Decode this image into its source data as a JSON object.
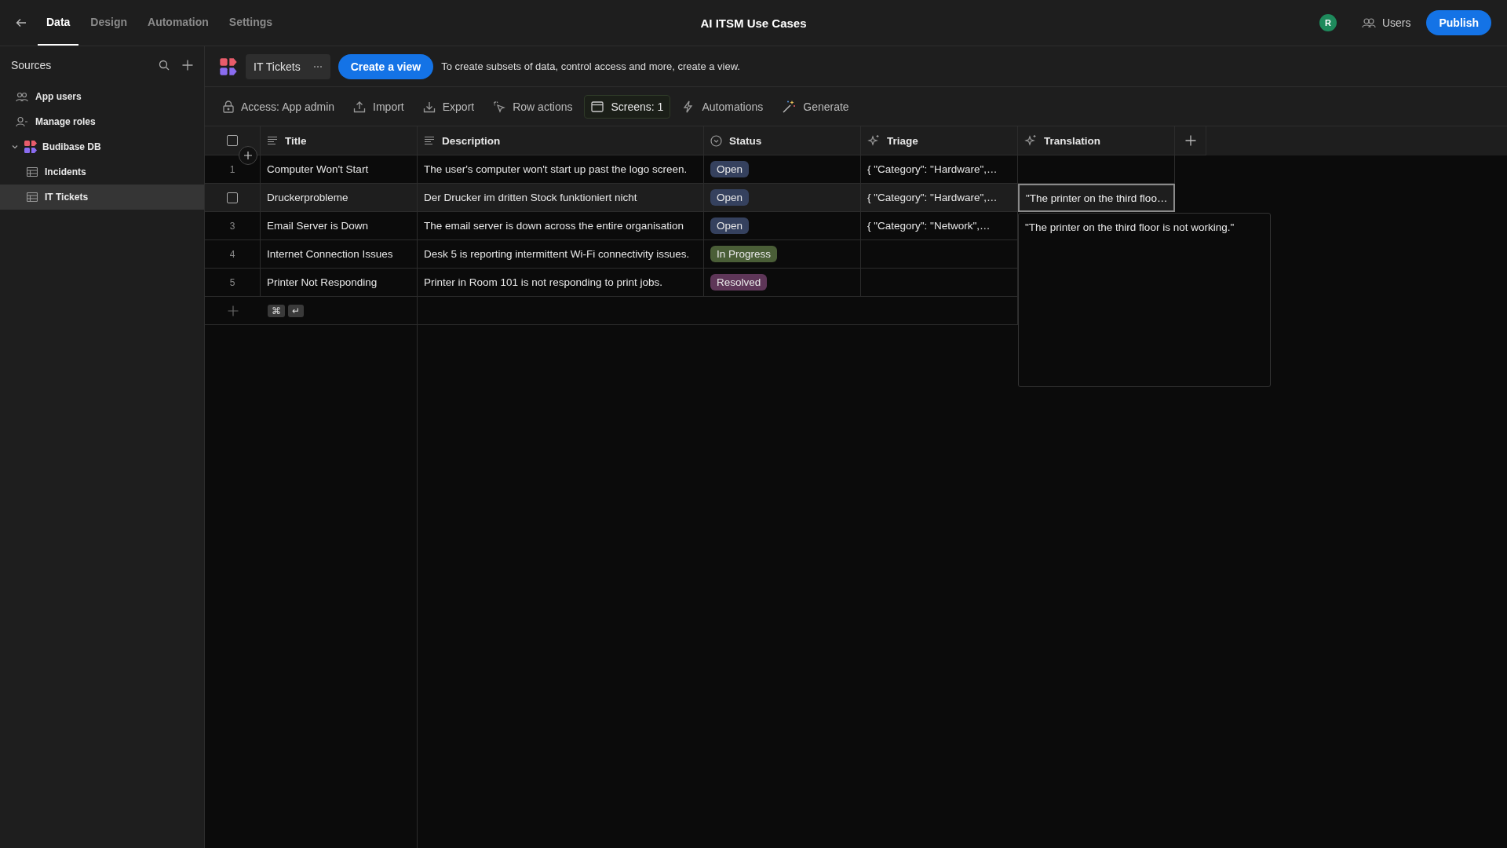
{
  "topbar": {
    "tabs": [
      {
        "label": "Data",
        "selected": true
      },
      {
        "label": "Design",
        "selected": false
      },
      {
        "label": "Automation",
        "selected": false
      },
      {
        "label": "Settings",
        "selected": false
      }
    ],
    "title": "AI ITSM Use Cases",
    "avatar": "R",
    "users": "Users",
    "publish": "Publish"
  },
  "sidebar": {
    "title": "Sources",
    "items": [
      {
        "label": "App users",
        "kind": "users",
        "selected": false
      },
      {
        "label": "Manage roles",
        "kind": "roles",
        "selected": false
      },
      {
        "label": "Budibase DB",
        "kind": "database",
        "selected": false,
        "expanded": true,
        "children": [
          {
            "label": "Incidents",
            "kind": "table",
            "selected": false
          },
          {
            "label": "IT Tickets",
            "kind": "table",
            "selected": true
          }
        ]
      }
    ]
  },
  "table_bar": {
    "name": "IT Tickets",
    "create_view": "Create a view",
    "hint": "To create subsets of data, control access and more, create a view."
  },
  "toolbar": [
    {
      "label": "Access: App admin",
      "kind": "lock",
      "active": false
    },
    {
      "label": "Import",
      "kind": "import",
      "active": false
    },
    {
      "label": "Export",
      "kind": "export",
      "active": false
    },
    {
      "label": "Row actions",
      "kind": "cursor",
      "active": false
    },
    {
      "label": "Screens: 1",
      "kind": "screen",
      "active": true
    },
    {
      "label": "Automations",
      "kind": "bolt",
      "active": false
    },
    {
      "label": "Generate",
      "kind": "wand",
      "active": false
    }
  ],
  "table": {
    "select_all_checked": false,
    "columns": [
      {
        "label": "Title",
        "kind": "text"
      },
      {
        "label": "Description",
        "kind": "text"
      },
      {
        "label": "Status",
        "kind": "options"
      },
      {
        "label": "Triage",
        "kind": "ai"
      },
      {
        "label": "Translation",
        "kind": "ai"
      }
    ],
    "rows": [
      {
        "number": "1",
        "highlighted": false,
        "title": "Computer Won't Start",
        "description": "The user's computer won't start up past the logo screen.",
        "status": {
          "label": "Open",
          "color": "#35415e"
        },
        "triage": "{ \"Category\": \"Hardware\",…",
        "translation_selected": false
      },
      {
        "highlighted": true,
        "checked": false,
        "title": "Druckerprobleme",
        "description": "Der Drucker im dritten Stock funktioniert nicht",
        "status": {
          "label": "Open",
          "color": "#35415e"
        },
        "triage": "{ \"Category\": \"Hardware\",…",
        "translation": "\"The printer on the third floo…",
        "translation_selected": true
      },
      {
        "number": "3",
        "highlighted": false,
        "title": "Email Server is Down",
        "description": "The email server is down across the entire organisation",
        "status": {
          "label": "Open",
          "color": "#35415e"
        },
        "triage": "{ \"Category\": \"Network\",…"
      },
      {
        "number": "4",
        "highlighted": false,
        "title": "Internet Connection Issues",
        "description": "Desk 5 is reporting intermittent Wi-Fi connectivity issues.",
        "status": {
          "label": "In Progress",
          "color": "#4a5e37"
        }
      },
      {
        "number": "5",
        "highlighted": false,
        "title": "Printer Not Responding",
        "description": "Printer in Room 101 is not responding to print jobs.",
        "status": {
          "label": "Resolved",
          "color": "#5e3658"
        }
      }
    ],
    "add_row_keys": [
      "⌘",
      "↵"
    ],
    "expanded_cell": {
      "text": "\"The printer on the third floor is not working.\""
    }
  }
}
